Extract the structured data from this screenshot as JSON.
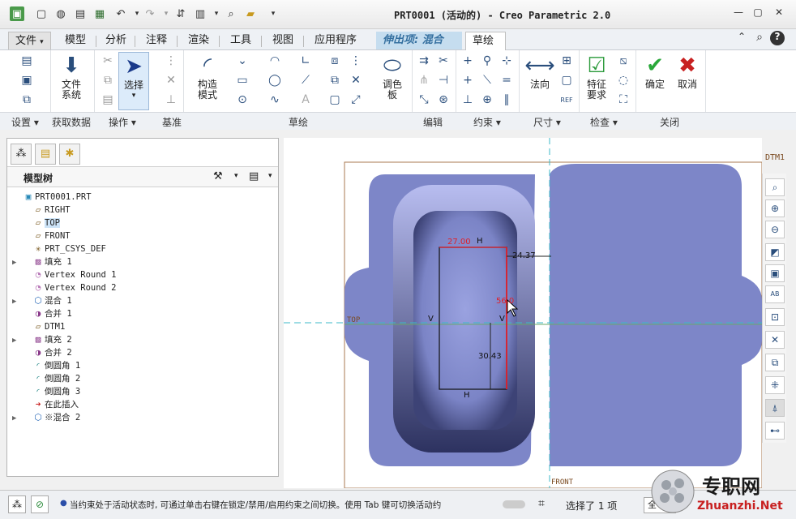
{
  "window": {
    "title": "PRT0001 (活动的) - Creo Parametric 2.0"
  },
  "tabs": [
    {
      "label": "文件"
    },
    {
      "label": "模型"
    },
    {
      "label": "分析"
    },
    {
      "label": "注释"
    },
    {
      "label": "渲染"
    },
    {
      "label": "工具"
    },
    {
      "label": "视图"
    },
    {
      "label": "应用程序"
    },
    {
      "label": "伸出项: 混合"
    },
    {
      "label": "草绘"
    }
  ],
  "ribbon": {
    "file_system": "文件\n系统",
    "file_system_l1": "文件",
    "file_system_l2": "系统",
    "select": "选择",
    "construction_l1": "构造",
    "construction_l2": "模式",
    "palette_l1": "调色",
    "palette_l2": "板",
    "normal": "法向",
    "feature_req_l1": "特征",
    "feature_req_l2": "要求",
    "ok": "确定",
    "cancel": "取消",
    "groups": {
      "setup": "设置",
      "get_data": "获取数据",
      "operations": "操作",
      "datum": "基准",
      "sketch": "草绘",
      "editing": "编辑",
      "constrain": "约束",
      "dimension": "尺寸",
      "inspect": "检查",
      "close": "关闭"
    }
  },
  "model_tree": {
    "title": "模型树",
    "items": [
      {
        "label": "PRT0001.PRT",
        "icon": "part-icon"
      },
      {
        "label": "RIGHT",
        "icon": "datum-plane-icon"
      },
      {
        "label": "TOP",
        "icon": "datum-plane-icon"
      },
      {
        "label": "FRONT",
        "icon": "datum-plane-icon"
      },
      {
        "label": "PRT_CSYS_DEF",
        "icon": "csys-icon"
      },
      {
        "label": "填充 1",
        "icon": "fill-icon"
      },
      {
        "label": "Vertex Round 1",
        "icon": "round-icon"
      },
      {
        "label": "Vertex Round 2",
        "icon": "round-icon"
      },
      {
        "label": "混合 1",
        "icon": "blend-icon"
      },
      {
        "label": "合并 1",
        "icon": "merge-icon"
      },
      {
        "label": "DTM1",
        "icon": "datum-plane-icon"
      },
      {
        "label": "填充 2",
        "icon": "fill-icon"
      },
      {
        "label": "合并 2",
        "icon": "merge-icon"
      },
      {
        "label": "倒圆角 1",
        "icon": "round-icon"
      },
      {
        "label": "倒圆角 2",
        "icon": "round-icon"
      },
      {
        "label": "倒圆角 3",
        "icon": "round-icon"
      },
      {
        "label": "在此插入",
        "icon": "insert-arrow-icon"
      },
      {
        "label": "※混合 2",
        "icon": "blend-icon"
      }
    ]
  },
  "canvas": {
    "datum_labels": {
      "dtm1": "DTM1",
      "front": "FRONT",
      "top": "TOP"
    },
    "dimensions": {
      "width": "27.00",
      "right_offset": "24.37",
      "height": "56.0",
      "lower": "30.43"
    },
    "constraint_labels": {
      "h": "H",
      "v": "V"
    }
  },
  "status": {
    "message": "当约束处于活动状态时, 可通过单击右键在锁定/禁用/启用约束之间切换。使用 Tab 键可切换活动约",
    "selection": "选择了 1 项",
    "filter": "全"
  },
  "watermark": {
    "text_cn": "专职网",
    "text_en": "Zhuanzhi.Net"
  },
  "colors": {
    "model_fill": "#7d86c8",
    "model_shadow": "#3f4679",
    "dim_red": "#e0202a",
    "datum_cyan": "#3cb8c8",
    "accent_blue": "#2a4e7c"
  }
}
